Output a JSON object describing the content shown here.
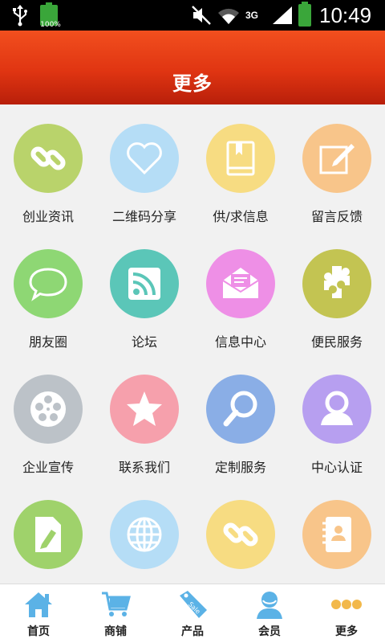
{
  "status_bar": {
    "battery_percent": "100%",
    "network": "3G",
    "time": "10:49"
  },
  "header": {
    "title": "更多"
  },
  "grid": [
    {
      "label": "创业资讯",
      "icon": "link-icon",
      "color": "#b9d36b"
    },
    {
      "label": "二维码分享",
      "icon": "heart-icon",
      "color": "#b5ddf6"
    },
    {
      "label": "供/求信息",
      "icon": "book-icon",
      "color": "#f7dc82"
    },
    {
      "label": "留言反馈",
      "icon": "edit-icon",
      "color": "#f8c58a"
    },
    {
      "label": "朋友圈",
      "icon": "chat-bubble-icon",
      "color": "#8ed774"
    },
    {
      "label": "论坛",
      "icon": "rss-icon",
      "color": "#5bc6b8"
    },
    {
      "label": "信息中心",
      "icon": "mail-icon",
      "color": "#ee8fe6"
    },
    {
      "label": "便民服务",
      "icon": "puzzle-icon",
      "color": "#c3c452"
    },
    {
      "label": "企业宣传",
      "icon": "film-reel-icon",
      "color": "#bcc2c8"
    },
    {
      "label": "联系我们",
      "icon": "star-icon",
      "color": "#f6a0ac"
    },
    {
      "label": "定制服务",
      "icon": "magnifier-icon",
      "color": "#8aaee6"
    },
    {
      "label": "中心认证",
      "icon": "user-icon",
      "color": "#b79ff0"
    },
    {
      "label": "",
      "icon": "document-pen-icon",
      "color": "#9fd26b"
    },
    {
      "label": "",
      "icon": "globe-icon",
      "color": "#b5ddf6"
    },
    {
      "label": "",
      "icon": "link-icon",
      "color": "#f7dc82"
    },
    {
      "label": "",
      "icon": "contacts-book-icon",
      "color": "#f8c58a"
    }
  ],
  "tabbar": {
    "items": [
      {
        "label": "首页",
        "icon": "home-icon"
      },
      {
        "label": "商铺",
        "icon": "cart-icon"
      },
      {
        "label": "产品",
        "icon": "sale-tag-icon"
      },
      {
        "label": "会员",
        "icon": "member-icon"
      },
      {
        "label": "更多",
        "icon": "more-dots-icon"
      }
    ],
    "icon_color": "#5bb2e6",
    "more_dots_color": "#f2b84a"
  }
}
